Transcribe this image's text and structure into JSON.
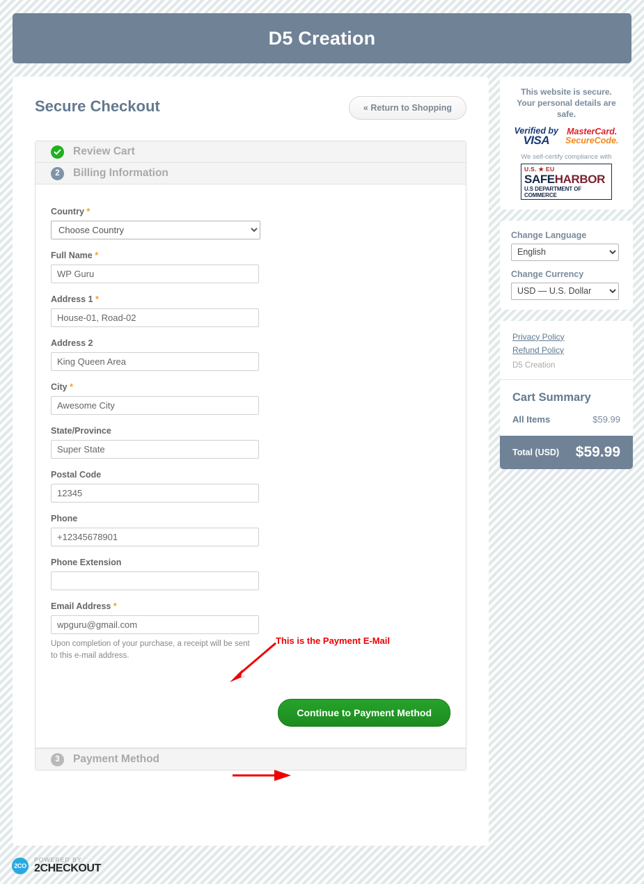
{
  "header": {
    "brand_title": "D5 Creation"
  },
  "page": {
    "title": "Secure Checkout",
    "return_button": "« Return to Shopping"
  },
  "steps": [
    {
      "badge": "check-icon",
      "label": "Review Cart",
      "state": "done"
    },
    {
      "badge": "2",
      "label": "Billing Information",
      "state": "active"
    },
    {
      "badge": "3",
      "label": "Payment Method",
      "state": "todo"
    }
  ],
  "form": {
    "country": {
      "label": "Country",
      "required": "*",
      "value": "Choose Country"
    },
    "full_name": {
      "label": "Full Name",
      "required": "*",
      "value": "WP Guru"
    },
    "address1": {
      "label": "Address 1",
      "required": "*",
      "value": "House-01, Road-02"
    },
    "address2": {
      "label": "Address 2",
      "required": "",
      "value": "King Queen Area"
    },
    "city": {
      "label": "City",
      "required": "*",
      "value": "Awesome City"
    },
    "state": {
      "label": "State/Province",
      "required": "",
      "value": "Super State"
    },
    "postal": {
      "label": "Postal Code",
      "required": "",
      "value": "12345"
    },
    "phone": {
      "label": "Phone",
      "required": "",
      "value": "+12345678901"
    },
    "phone_ext": {
      "label": "Phone Extension",
      "required": "",
      "value": ""
    },
    "email": {
      "label": "Email Address",
      "required": "*",
      "value": "wpguru@gmail.com"
    },
    "email_help": "Upon completion of your purchase, a receipt will be sent to this e-mail address.",
    "continue_button": "Continue to Payment Method"
  },
  "annotations": [
    {
      "text": "This is the Payment E-Mail",
      "color": "#ee0000"
    }
  ],
  "sidebar": {
    "security": {
      "note": "This website is secure. Your personal details are safe.",
      "verified_by": "Verified by",
      "visa": "VISA",
      "mastercard": "MasterCard.",
      "securecode": "SecureCode.",
      "selfcert": "We self-certify compliance with",
      "safeharbor_top": "U.S. ★ EU",
      "safeharbor_safe": "SAFE",
      "safeharbor_harbor": "HARBOR",
      "safeharbor_bottom": "U.S DEPARTMENT OF COMMERCE"
    },
    "locale": {
      "language_label": "Change Language",
      "language_value": "English",
      "currency_label": "Change Currency",
      "currency_value": "USD — U.S. Dollar"
    },
    "policies": {
      "privacy": "Privacy Policy",
      "refund": "Refund Policy",
      "vendor": "D5 Creation"
    },
    "cart": {
      "title": "Cart Summary",
      "items_label": "All Items",
      "items_value": "$59.99",
      "total_label": "Total (USD)",
      "total_value": "$59.99"
    }
  },
  "footer": {
    "badge": "2CO",
    "powered_by": "POWERED BY",
    "name": "2CHECKOUT"
  },
  "colors": {
    "brand_bar": "#6f8296",
    "accent_green": "#1fb11f",
    "annotation_red": "#ee0000",
    "required_orange": "#f0a02a"
  }
}
